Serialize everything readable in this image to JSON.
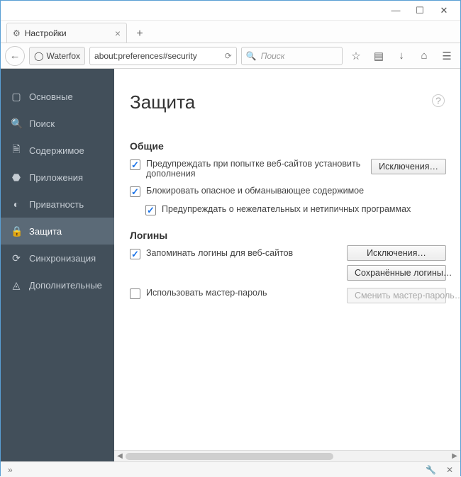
{
  "window": {
    "tab_title": "Настройки",
    "browser_name": "Waterfox",
    "url": "about:preferences#security",
    "search_placeholder": "Поиск"
  },
  "sidebar": {
    "items": [
      {
        "label": "Основные"
      },
      {
        "label": "Поиск"
      },
      {
        "label": "Содержимое"
      },
      {
        "label": "Приложения"
      },
      {
        "label": "Приватность"
      },
      {
        "label": "Защита"
      },
      {
        "label": "Синхронизация"
      },
      {
        "label": "Дополнительные"
      }
    ]
  },
  "page": {
    "title": "Защита",
    "general": {
      "heading": "Общие",
      "warn_addons_label": "Предупреждать при попытке веб-сайтов установить дополнения",
      "exceptions_btn": "Исключения…",
      "block_dangerous_label": "Блокировать опасное и обманывающее содержимое",
      "warn_unwanted_label": "Предупреждать о нежелательных и нетипичных программах"
    },
    "logins": {
      "heading": "Логины",
      "remember_label": "Запоминать логины для веб-сайтов",
      "exceptions_btn": "Исключения…",
      "saved_btn": "Сохранённые логины…",
      "master_label": "Использовать мастер-пароль",
      "change_master_btn": "Сменить мастер-пароль…"
    }
  }
}
